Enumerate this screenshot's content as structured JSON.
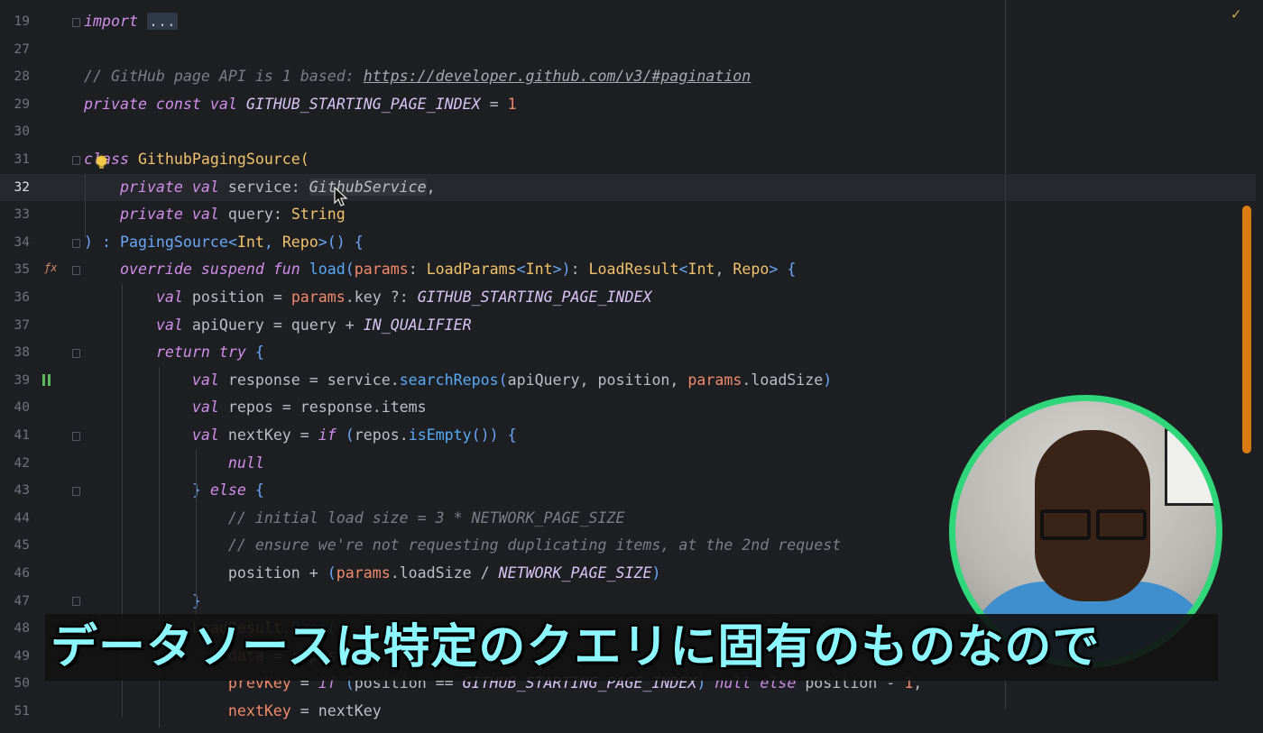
{
  "editor": {
    "lines": [
      {
        "num": "19",
        "text": "import ..."
      },
      {
        "num": "27",
        "text": ""
      },
      {
        "num": "28",
        "text": "// GitHub page API is 1 based: https://developer.github.com/v3/#pagination"
      },
      {
        "num": "29",
        "text": "private const val GITHUB_STARTING_PAGE_INDEX = 1"
      },
      {
        "num": "30",
        "text": ""
      },
      {
        "num": "31",
        "text": "class GithubPagingSource("
      },
      {
        "num": "32",
        "text": "    private val service: GithubService,"
      },
      {
        "num": "33",
        "text": "    private val query: String"
      },
      {
        "num": "34",
        "text": ") : PagingSource<Int, Repo>() {"
      },
      {
        "num": "35",
        "text": "    override suspend fun load(params: LoadParams<Int>): LoadResult<Int, Repo> {"
      },
      {
        "num": "36",
        "text": "        val position = params.key ?: GITHUB_STARTING_PAGE_INDEX"
      },
      {
        "num": "37",
        "text": "        val apiQuery = query + IN_QUALIFIER"
      },
      {
        "num": "38",
        "text": "        return try {"
      },
      {
        "num": "39",
        "text": "            val response = service.searchRepos(apiQuery, position, params.loadSize)"
      },
      {
        "num": "40",
        "text": "            val repos = response.items"
      },
      {
        "num": "41",
        "text": "            val nextKey = if (repos.isEmpty()) {"
      },
      {
        "num": "42",
        "text": "                null"
      },
      {
        "num": "43",
        "text": "            } else {"
      },
      {
        "num": "44",
        "text": "                // initial load size = 3 * NETWORK_PAGE_SIZE"
      },
      {
        "num": "45",
        "text": "                // ensure we're not requesting duplicating items, at the 2nd request"
      },
      {
        "num": "46",
        "text": "                position + (params.loadSize / NETWORK_PAGE_SIZE)"
      },
      {
        "num": "47",
        "text": "            }"
      },
      {
        "num": "48",
        "text": "            LoadResult.Page("
      },
      {
        "num": "49",
        "text": "                data = repos,"
      },
      {
        "num": "50",
        "text": "                prevKey = if (position == GITHUB_STARTING_PAGE_INDEX) null else position - 1,"
      },
      {
        "num": "51",
        "text": "                nextKey = nextKey"
      }
    ],
    "current_line": "32"
  },
  "icons": {
    "inspection": "check-icon",
    "intention": "lightbulb-icon",
    "override": "override-function-icon",
    "breakpoint": "pause-icon",
    "pointer": "mouse-cursor-icon"
  },
  "subtitle": {
    "text": "データソースは特定のクエリに固有のものなので"
  },
  "colors": {
    "background": "#1e1f22",
    "keyword": "#cf8ee8",
    "class_name": "#f0c26d",
    "type": "#6aa7f8",
    "function": "#57aaf7",
    "parameter": "#f08a6c",
    "comment": "#7a7e85",
    "scrollbar": "#d97b10",
    "webcam_ring": "#2fd67a",
    "subtitle": "#8cf6ff"
  }
}
